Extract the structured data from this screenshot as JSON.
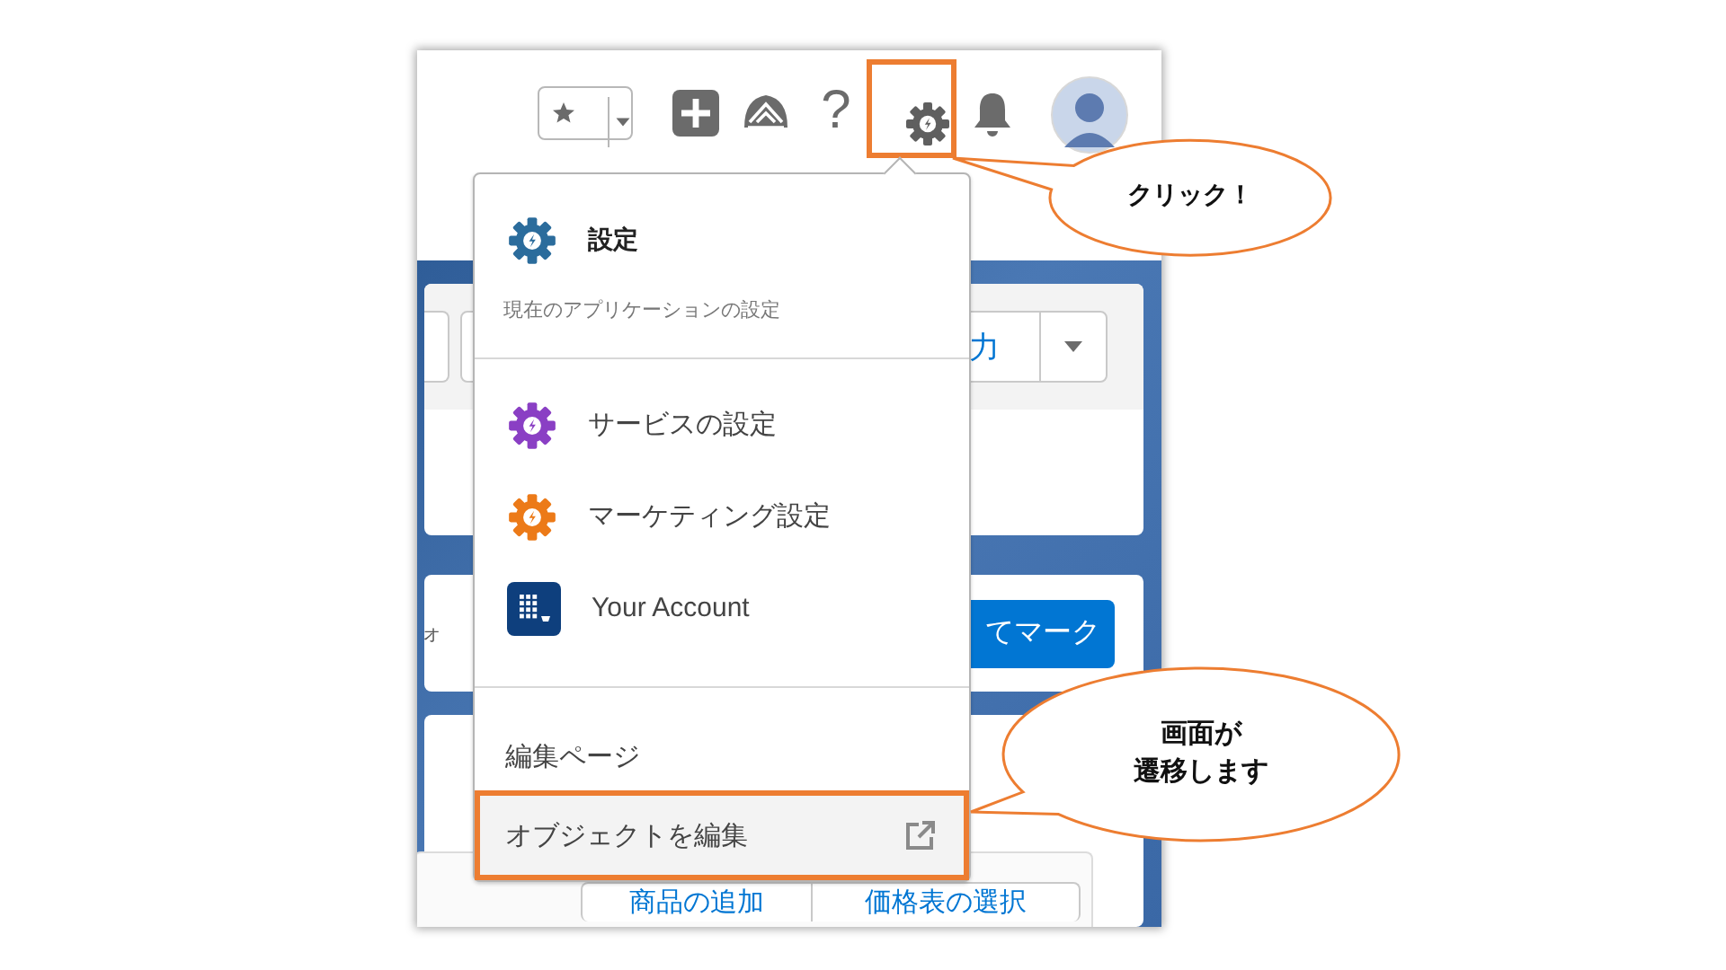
{
  "toolbar": {
    "help_glyph": "?",
    "settings_highlighted": true
  },
  "menu": {
    "items": [
      {
        "kind": "primary",
        "label": "設定",
        "description": "現在のアプリケーションの設定",
        "color": "#2b6c9c"
      },
      {
        "kind": "gear",
        "label": "サービスの設定",
        "color": "#8a3fc4"
      },
      {
        "kind": "gear",
        "label": "マーケティング設定",
        "color": "#ec7a18"
      },
      {
        "kind": "account",
        "label": "Your Account",
        "color": "#0e3f7d"
      }
    ],
    "section_title": "編集ページ",
    "links": [
      {
        "label": "オブジェクトを編集",
        "highlighted": true
      }
    ]
  },
  "background": {
    "card_1": {
      "button_text": "力"
    },
    "card_2": {
      "field_text": "ォ",
      "button_text": "てマーク"
    },
    "card_3": {
      "buttons": [
        "商品の追加",
        "価格表の選択"
      ]
    }
  },
  "callouts": [
    {
      "lines": [
        "クリック！"
      ]
    },
    {
      "lines": [
        "画面が",
        "遷移します"
      ]
    }
  ]
}
